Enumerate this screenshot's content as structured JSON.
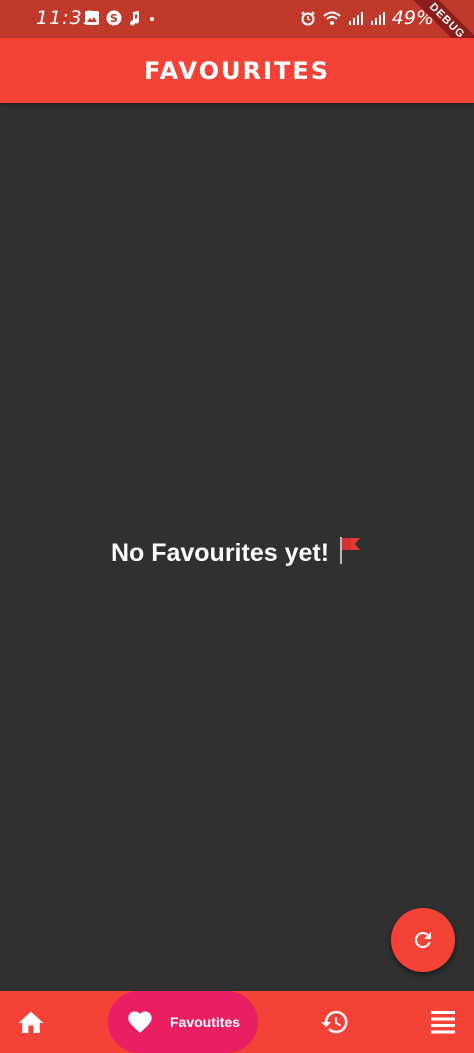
{
  "status_bar": {
    "time": "11:31",
    "battery": "49%",
    "debug_label": "DEBUG"
  },
  "app_bar": {
    "title": "FAVOURITES"
  },
  "empty_state": {
    "message": "No Favourites yet!"
  },
  "fab": {
    "icon": "refresh-icon"
  },
  "bottom_nav": {
    "items": [
      {
        "icon": "home-icon"
      },
      {
        "icon": "heart-icon",
        "label": "Favoutites",
        "selected": true
      },
      {
        "icon": "history-icon"
      },
      {
        "icon": "menu-icon"
      }
    ]
  },
  "colors": {
    "primary": "#f44336",
    "selected_nav": "#e91e63",
    "background": "#303030",
    "status_bar": "#c0392b"
  }
}
